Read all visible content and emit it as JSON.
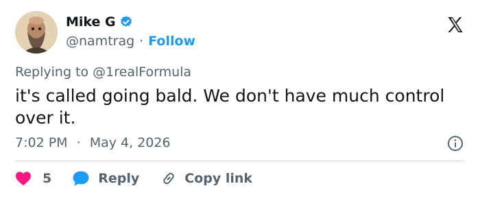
{
  "author": {
    "display_name": "Mike G",
    "handle": "@namtrag",
    "separator": "·",
    "follow_label": "Follow"
  },
  "reply_context": {
    "prefix": "Replying to ",
    "mention": "@1realFormula"
  },
  "tweet": {
    "text": "it's called going bald.  We don't have much control over it.",
    "time": "7:02 PM",
    "separator": "·",
    "date": "May 4, 2026"
  },
  "actions": {
    "like_count": "5",
    "reply_label": "Reply",
    "copy_link_label": "Copy link"
  },
  "colors": {
    "accent": "#1d9bf0",
    "like": "#f91880",
    "muted": "#536471",
    "text": "#0f1419"
  },
  "icons": [
    "verified-badge-icon",
    "x-logo-icon",
    "info-icon",
    "heart-icon",
    "reply-bubble-icon",
    "link-icon"
  ]
}
